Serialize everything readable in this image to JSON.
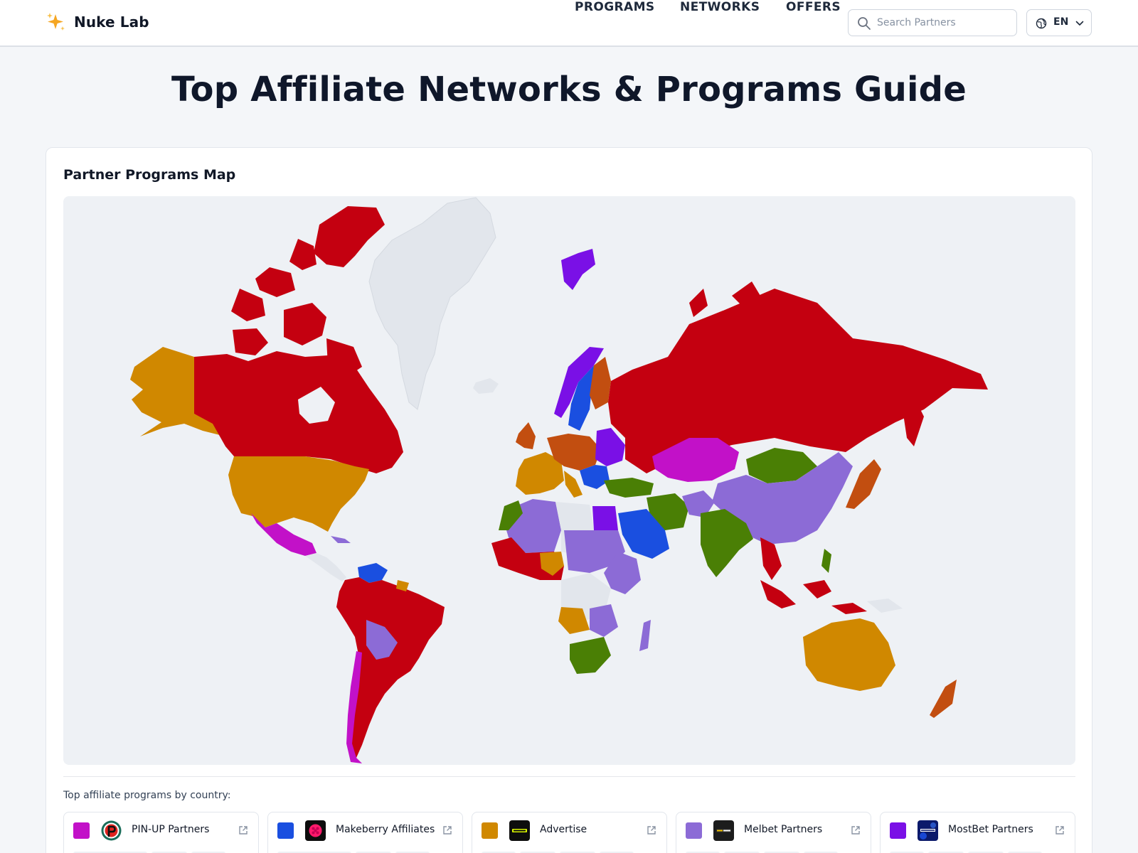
{
  "brand": {
    "name": "Nuke Lab",
    "icon": "sparkles-icon"
  },
  "nav": {
    "items": [
      {
        "label": "PROGRAMS"
      },
      {
        "label": "NETWORKS"
      },
      {
        "label": "OFFERS"
      }
    ]
  },
  "search": {
    "placeholder": "Search Partners",
    "icon": "search-icon"
  },
  "language": {
    "code": "EN",
    "icon": "globe-icon"
  },
  "page": {
    "title": "Top Affiliate Networks & Programs Guide"
  },
  "map_card": {
    "title": "Partner Programs Map",
    "legend_caption": "Top affiliate programs by country:"
  },
  "colors": {
    "pinup": "#c211c8",
    "makeberry": "#1a4fe0",
    "advertise": "#d08800",
    "melbet": "#8c6bd6",
    "mostbet": "#7a10e6",
    "red": "#c40010",
    "green": "#4a7f05",
    "rust": "#c24e10",
    "unassigned": "#e2e6ec",
    "ocean": "#eef1f5"
  },
  "programs": [
    {
      "name": "PIN-UP Partners",
      "color": "#c211c8",
      "logo": "pinup-logo"
    },
    {
      "name": "Makeberry Affiliates",
      "color": "#1a4fe0",
      "logo": "makeberry-logo"
    },
    {
      "name": "Advertise",
      "color": "#d08800",
      "logo": "advertise-logo"
    },
    {
      "name": "Melbet Partners",
      "color": "#8c6bd6",
      "logo": "melbet-logo"
    },
    {
      "name": "MostBet Partners",
      "color": "#7a10e6",
      "logo": "mostbet-logo"
    }
  ]
}
